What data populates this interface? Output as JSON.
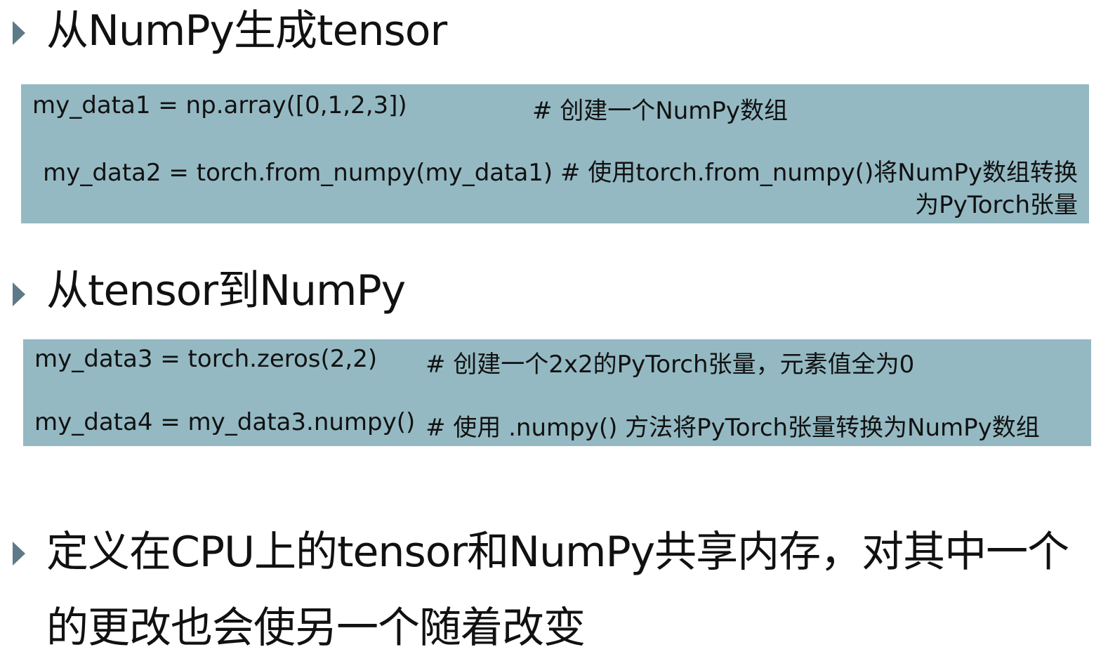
{
  "sections": [
    {
      "heading": "从NumPy生成tensor",
      "code": {
        "line1_code": "my_data1 = np.array([0,1,2,3])",
        "line1_comment": "# 创建一个NumPy数组",
        "line2_part1": "my_data2 = torch.from_numpy(my_data1) # 使用torch.from_numpy()将NumPy数组转换",
        "line2_part2": "为PyTorch张量"
      }
    },
    {
      "heading": "从tensor到NumPy",
      "code": {
        "line1_code": "my_data3 = torch.zeros(2,2)",
        "line1_comment": "# 创建一个2x2的PyTorch张量，元素值全为0",
        "line2_code": "my_data4 = my_data3.numpy()",
        "line2_comment": "# 使用 .numpy() 方法将PyTorch张量转换为NumPy数组"
      }
    },
    {
      "paragraph_line1": "定义在CPU上的tensor和NumPy共享内存，对其中一个",
      "paragraph_line2": "的更改也会使另一个随着改变"
    }
  ],
  "colors": {
    "code_bg": "#94b9c3",
    "bullet": "#5d7a86"
  }
}
